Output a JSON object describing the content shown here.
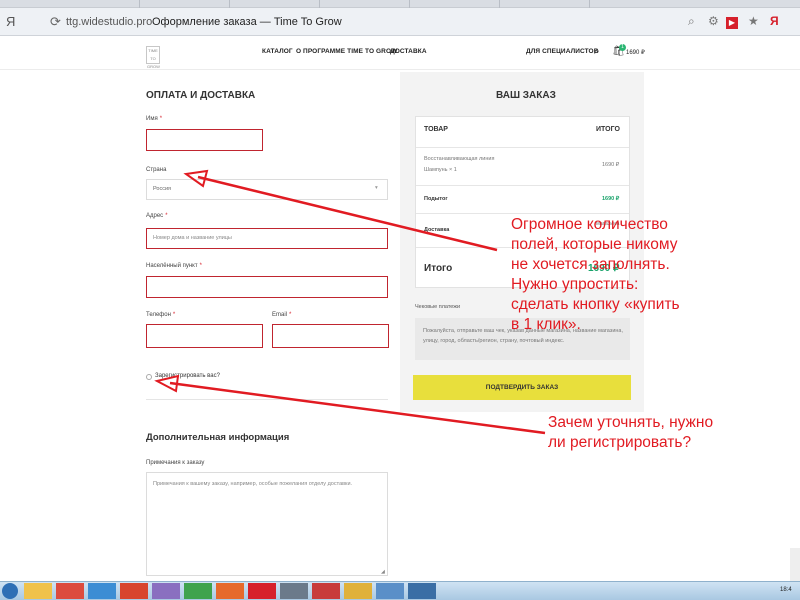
{
  "browser": {
    "yandex_glyph": "Я",
    "host": "ttg.widestudio.pro",
    "title": "Оформление заказа — Time To Grow"
  },
  "header": {
    "logo_text": "TIME TO GROW",
    "nav": [
      "КАТАЛОГ",
      "О ПРОГРАММЕ TIME TO GROW",
      "ДОСТАВКА"
    ],
    "specialists": "ДЛЯ СПЕЦИАЛИСТОВ",
    "cart_count": "1",
    "cart_total": "1690 ₽"
  },
  "form": {
    "heading": "ОПЛАТА И ДОСТАВКА",
    "name_label": "Имя",
    "country_label": "Страна",
    "country_value": "Россия",
    "address_label": "Адрес",
    "address_placeholder": "Номер дома и название улицы",
    "city_label": "Населённый пункт",
    "phone_label": "Телефон",
    "email_label": "Email",
    "register_label": "Зарегистрировать вас?",
    "extra_heading": "Дополнительная информация",
    "notes_label": "Примечания к заказу",
    "notes_placeholder": "Примечания к вашему заказу, например, особые пожелания отделу доставки.",
    "req_mark": "*"
  },
  "order": {
    "title": "ВАШ ЗАКАЗ",
    "col_product": "ТОВАР",
    "col_total": "ИТОГО",
    "item_line1": "Восстанавливающая линия",
    "item_line2": "Шампунь × 1",
    "item_price": "1690 ₽",
    "subtotal_label": "Подытог",
    "subtotal_value": "1690 ₽",
    "shipping_label": "Доставка",
    "shipping_note": "магазина",
    "total_label": "Итого",
    "total_value": "1690 ₽",
    "payment_label": "Чековые платежи",
    "payment_hint": "Пожалуйста, отправьте ваш чек, указав данные магазина, название магазина, улицу, город, область/регион, страну, почтовый индекс.",
    "confirm_button": "ПОДТВЕРДИТЬ ЗАКАЗ"
  },
  "annotations": {
    "note1": [
      "Огромное количество",
      "полей, которые никому",
      "не хочется заполнять.",
      "Нужно упростить:",
      "сделать кнопку «купить",
      "в 1 клик»."
    ],
    "note2": [
      "Зачем уточнять, нужно",
      "ли регистрировать?"
    ],
    "color": "#e11b22"
  },
  "taskbar": {
    "clock": "18:4"
  }
}
